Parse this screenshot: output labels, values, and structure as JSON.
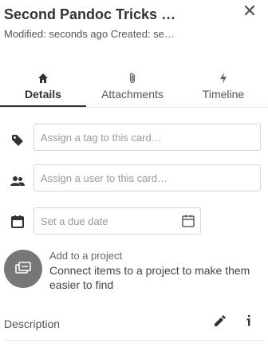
{
  "card": {
    "title": "Second Pandoc Tricks …",
    "meta": "Modified: seconds ago Created: se…"
  },
  "tabs": [
    {
      "label": "Details",
      "icon": "home-icon",
      "active": true
    },
    {
      "label": "Attachments",
      "icon": "paperclip-icon",
      "active": false
    },
    {
      "label": "Timeline",
      "icon": "lightning-icon",
      "active": false
    }
  ],
  "fields": {
    "tag_placeholder": "Assign a tag to this card…",
    "user_placeholder": "Assign a user to this card…",
    "date_placeholder": "Set a due date"
  },
  "project": {
    "title": "Add to a project",
    "description": "Connect items to a project to make them easier to find"
  },
  "description": {
    "label": "Description"
  }
}
